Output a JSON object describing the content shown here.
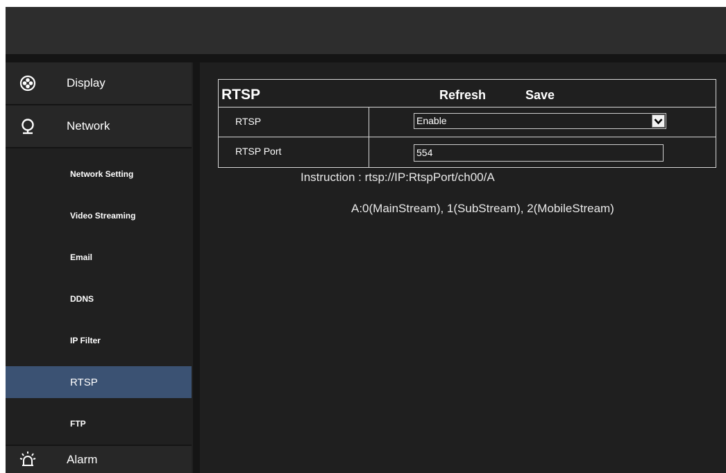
{
  "sidebar": {
    "sections": [
      {
        "label": "Display",
        "icon": "display-icon"
      },
      {
        "label": "Network",
        "icon": "network-icon"
      },
      {
        "label": "Alarm",
        "icon": "alarm-icon"
      }
    ],
    "sub_items": [
      {
        "label": "Network Setting"
      },
      {
        "label": "Video Streaming"
      },
      {
        "label": "Email"
      },
      {
        "label": "DDNS"
      },
      {
        "label": "IP Filter"
      },
      {
        "label": "RTSP",
        "active": true
      },
      {
        "label": "FTP"
      }
    ]
  },
  "panel": {
    "title": "RTSP",
    "refresh_label": "Refresh",
    "save_label": "Save",
    "rows": [
      {
        "label": "RTSP",
        "value": "Enable"
      },
      {
        "label": "RTSP Port",
        "value": "554"
      }
    ],
    "instruction_line1": "Instruction : rtsp://IP:RtspPort/ch00/A",
    "instruction_line2": "A:0(MainStream), 1(SubStream), 2(MobileStream)"
  },
  "colors": {
    "active_item": "#3b5273",
    "background": "#1f1f1f",
    "topbar": "#2d2d2d"
  }
}
